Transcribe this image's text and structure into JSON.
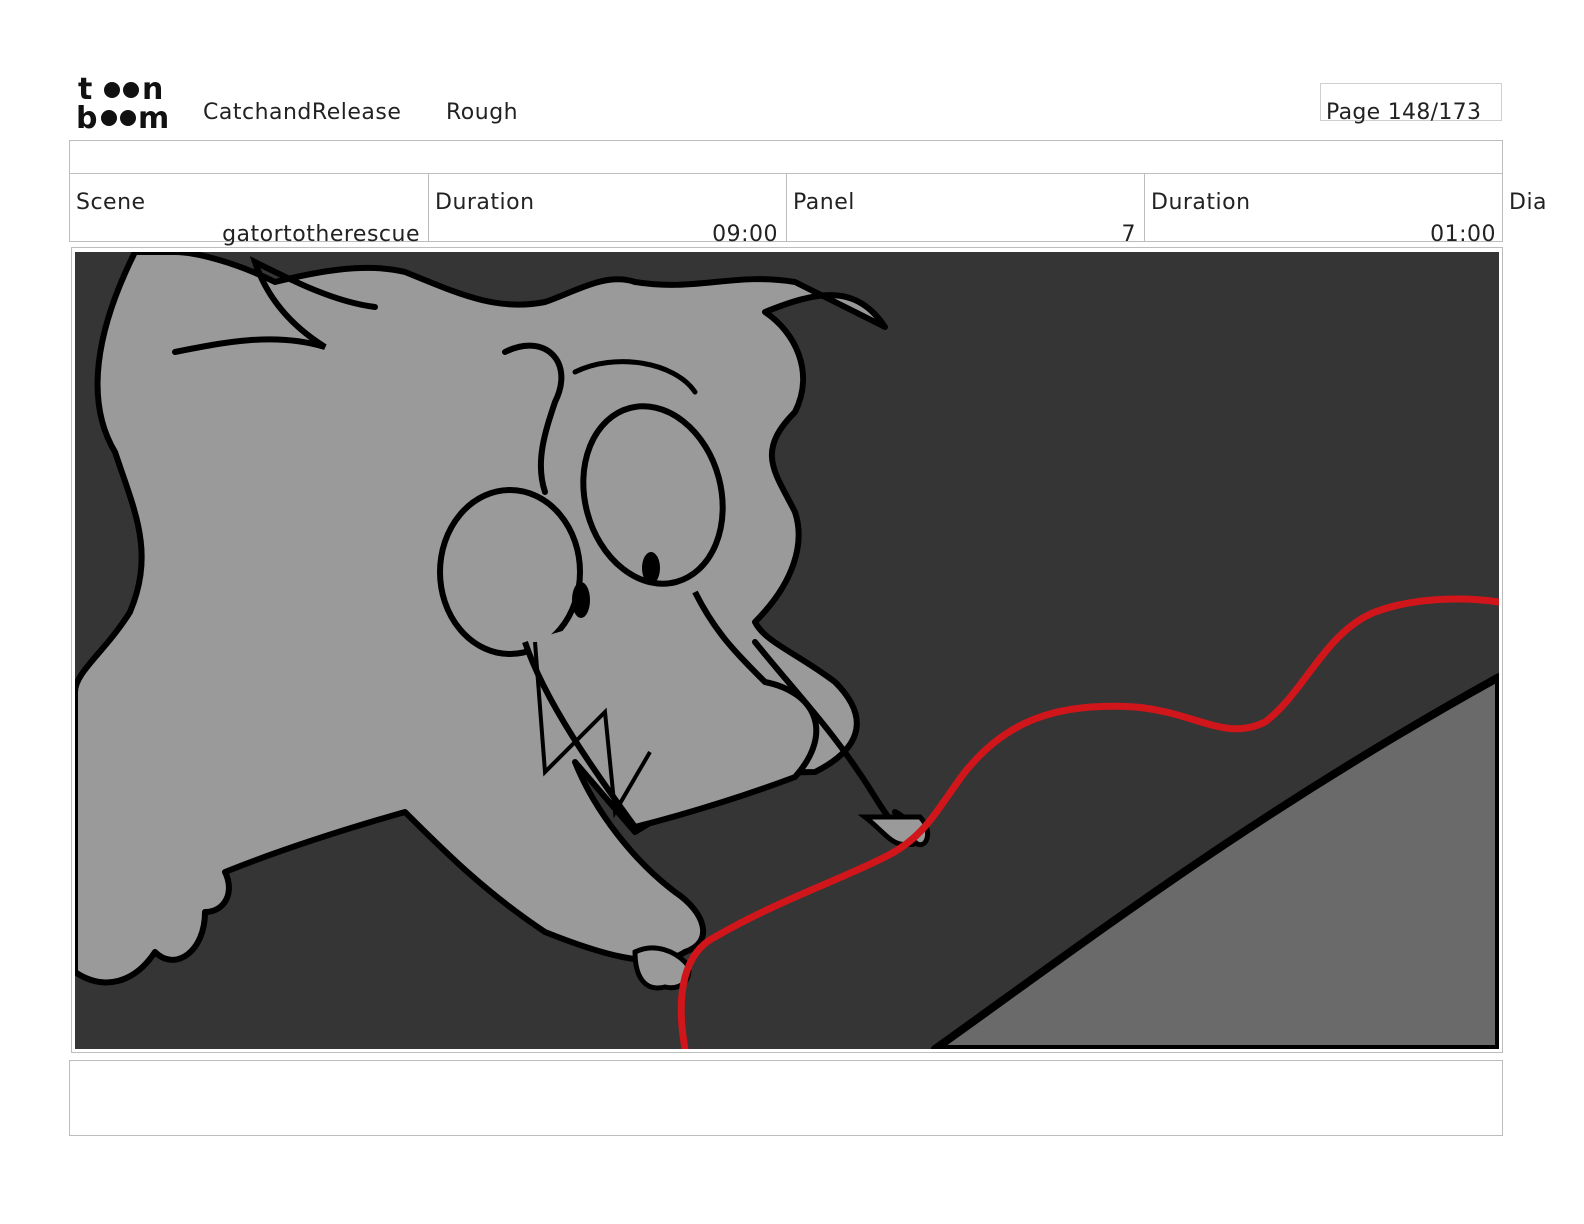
{
  "header": {
    "logo_text": "toonboom",
    "project": "CatchandRelease",
    "mode": "Rough",
    "page": "Page 148/173"
  },
  "info": {
    "scene_label": "Scene",
    "scene_value": "gatortotherescue",
    "duration_label": "Duration",
    "duration_value": "09:00",
    "panel_label": "Panel",
    "panel_value": "7",
    "panel_duration_label": "Duration",
    "panel_duration_value": "01:00",
    "dialogue_label": "Dia"
  },
  "panel": {
    "background_color": "#353535",
    "character_color": "#9a9a9a",
    "ground_color": "#6a6a6a",
    "rope_color": "#d0161a"
  },
  "caption": {
    "text": ""
  }
}
